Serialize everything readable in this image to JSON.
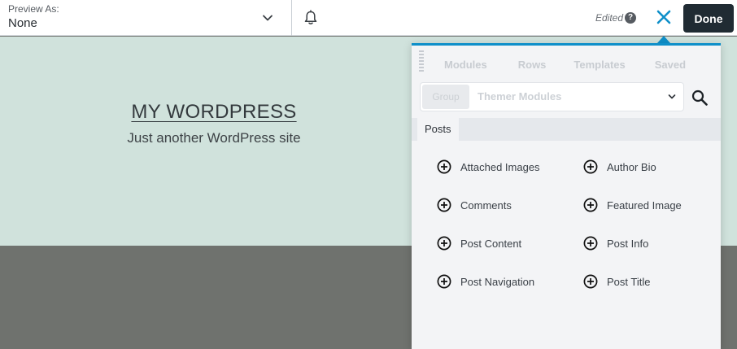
{
  "topbar": {
    "preview_label": "Preview As:",
    "preview_value": "None",
    "preview_chevron_icon": "chevron-down-icon",
    "notifications_icon": "bell-icon",
    "edited_label": "Edited",
    "help_glyph": "?",
    "close_icon": "close-icon",
    "done_label": "Done"
  },
  "site": {
    "title": "MY WORDPRESS",
    "tagline": "Just another WordPress site"
  },
  "panel": {
    "tabs": [
      {
        "label": "Modules"
      },
      {
        "label": "Rows"
      },
      {
        "label": "Templates"
      },
      {
        "label": "Saved"
      }
    ],
    "group_label": "Group",
    "group_select_value": "Themer Modules",
    "search_icon": "search-icon",
    "section_label": "Posts",
    "modules": [
      {
        "label": "Attached Images",
        "icon": "plus-circle-icon"
      },
      {
        "label": "Author Bio",
        "icon": "plus-circle-icon"
      },
      {
        "label": "Comments",
        "icon": "plus-circle-icon"
      },
      {
        "label": "Featured Image",
        "icon": "plus-circle-icon"
      },
      {
        "label": "Post Content",
        "icon": "plus-circle-icon"
      },
      {
        "label": "Post Info",
        "icon": "plus-circle-icon"
      },
      {
        "label": "Post Navigation",
        "icon": "plus-circle-icon"
      },
      {
        "label": "Post Title",
        "icon": "plus-circle-icon"
      }
    ]
  },
  "colors": {
    "accent": "#0e8fc9",
    "done_button": "#202b33",
    "hero_background": "#d0e2dc",
    "footer_background": "#6f726e"
  }
}
